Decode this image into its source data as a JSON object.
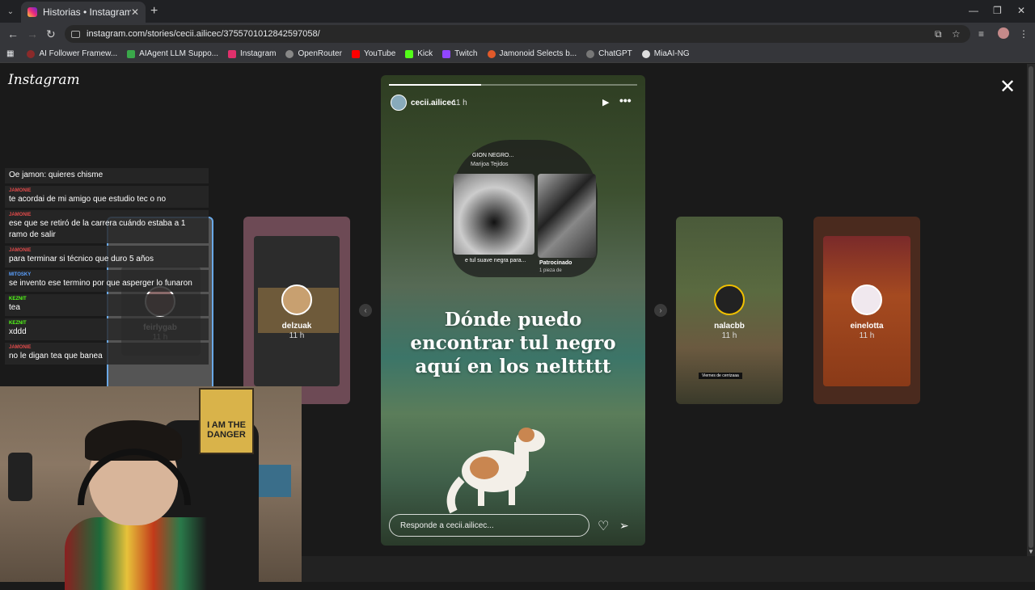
{
  "browser": {
    "tab_title": "Historias • Instagram",
    "tab_close": "✕",
    "new_tab": "+",
    "url": "instagram.com/stories/cecii.ailicec/3755701012842597058/",
    "bookmarks": [
      {
        "label": "AI Follower Framew...",
        "color": "#8a2a2a"
      },
      {
        "label": "AIAgent LLM Suppo...",
        "color": "#3aa84a"
      },
      {
        "label": "Instagram",
        "color": "#e1306c"
      },
      {
        "label": "OpenRouter",
        "color": "#888888"
      },
      {
        "label": "YouTube",
        "color": "#ff0000"
      },
      {
        "label": "Kick",
        "color": "#53fc18"
      },
      {
        "label": "Twitch",
        "color": "#9146ff"
      },
      {
        "label": "Jamonoid Selects b...",
        "color": "#e25a2a"
      },
      {
        "label": "ChatGPT",
        "color": "#777777"
      },
      {
        "label": "MiaAI-NG",
        "color": "#dddddd"
      }
    ]
  },
  "instagram": {
    "logo": "Instagram",
    "close": "✕",
    "main_story": {
      "username": "cecii.ailicec",
      "time": "11 h",
      "progress": 0.37,
      "sticker_title": "GION NEGRO...",
      "sticker_sub": "Marijoa Tejidos",
      "sticker_caption_left": "e tul suave negra para...",
      "sticker_caption_right": "Patrocinado",
      "sticker_caption_right_sub": "1 pieza de",
      "text": "Dónde puedo encontrar tul negro aquí en los nelttttt",
      "reply_placeholder": "Responde a cecii.ailicec..."
    },
    "side_stories": [
      {
        "username": "feirlygab",
        "time": "11 h"
      },
      {
        "username": "delzuak",
        "time": "11 h"
      },
      {
        "username": "nalacbb",
        "time": "11 h",
        "caption": "Viernes de cerrizaaa"
      },
      {
        "username": "einelotta",
        "time": "11 h"
      }
    ]
  },
  "chat": [
    {
      "user": "",
      "color": "#e24a4a",
      "msg": "Oe jamon: quieres chisme"
    },
    {
      "user": "JAMONIE",
      "color": "#e24a4a",
      "msg": "te acordai de mi amigo que estudio tec o no"
    },
    {
      "user": "JAMONIE",
      "color": "#e24a4a",
      "msg": "ese que se retiró de la carrera cuándo estaba a 1 ramo de salir"
    },
    {
      "user": "JAMONIE",
      "color": "#e24a4a",
      "msg": "para terminar si técnico que duro 5 años"
    },
    {
      "user": "MITOSKY",
      "color": "#5aa0ff",
      "msg": "se invento ese termino por que asperger lo funaron"
    },
    {
      "user": "KEZNIT",
      "color": "#53fc18",
      "msg": "tea"
    },
    {
      "user": "KEZNIT",
      "color": "#53fc18",
      "msg": "xddd"
    },
    {
      "user": "JAMONIE",
      "color": "#e24a4a",
      "msg": "no le digan tea que banea"
    }
  ],
  "webcam": {
    "poster_text": "I AM THE DANGER"
  }
}
